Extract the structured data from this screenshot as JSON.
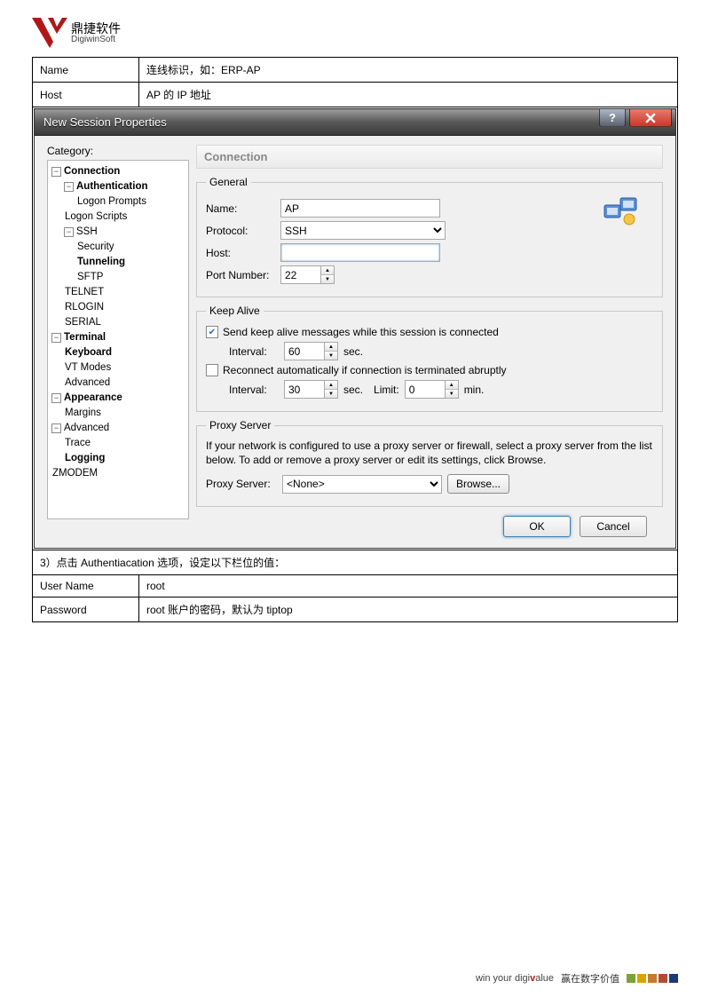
{
  "brand": {
    "name": "鼎捷软件",
    "sub": "DigiwinSoft"
  },
  "table1": {
    "name_label": "Name",
    "name_desc": "连线标识，如：ERP-AP",
    "host_label": "Host",
    "host_desc": "AP 的 IP 地址"
  },
  "dialog": {
    "title": "New Session Properties",
    "category_label": "Category:",
    "tree": {
      "connection": "Connection",
      "authentication": "Authentication",
      "logon_prompts": "Logon Prompts",
      "logon_scripts": "Logon Scripts",
      "ssh": "SSH",
      "security": "Security",
      "tunneling": "Tunneling",
      "sftp": "SFTP",
      "telnet": "TELNET",
      "rlogin": "RLOGIN",
      "serial": "SERIAL",
      "terminal": "Terminal",
      "keyboard": "Keyboard",
      "vt_modes": "VT Modes",
      "advanced_t": "Advanced",
      "appearance": "Appearance",
      "margins": "Margins",
      "advanced": "Advanced",
      "trace": "Trace",
      "logging": "Logging",
      "zmodem": "ZMODEM"
    },
    "panel_title": "Connection",
    "general": {
      "legend": "General",
      "name_label": "Name:",
      "name_value": "AP",
      "protocol_label": "Protocol:",
      "protocol_value": "SSH",
      "host_label": "Host:",
      "host_value": "",
      "port_label": "Port Number:",
      "port_value": "22"
    },
    "keepalive": {
      "legend": "Keep Alive",
      "send_label": "Send keep alive messages while this session is connected",
      "interval_label": "Interval:",
      "interval_value": "60",
      "sec_label": "sec.",
      "reconnect_label": "Reconnect automatically if connection is terminated abruptly",
      "interval2_label": "Interval:",
      "interval2_value": "30",
      "sec2_label": "sec.",
      "limit_label": "Limit:",
      "limit_value": "0",
      "min_label": "min."
    },
    "proxy": {
      "legend": "Proxy Server",
      "desc": "If your network is configured to use a proxy server or firewall, select a proxy server from the list below. To add or remove a proxy server or edit its settings, click Browse.",
      "label": "Proxy Server:",
      "value": "<None>",
      "browse": "Browse..."
    },
    "ok": "OK",
    "cancel": "Cancel"
  },
  "step3": "3）点击 Authentiacation 选项，设定以下栏位的值：",
  "table2": {
    "user_label": "User Name",
    "user_value": "root",
    "pwd_label": "Password",
    "pwd_value": "root 账户的密码，默认为 tiptop"
  },
  "footer": {
    "slogan_pre": "win your digi",
    "slogan_v": "v",
    "slogan_post": "alue",
    "cn": "赢在数字价值",
    "colors": [
      "#7aa13a",
      "#d9a400",
      "#c67a2c",
      "#b34b30",
      "#1a3a7a"
    ]
  }
}
